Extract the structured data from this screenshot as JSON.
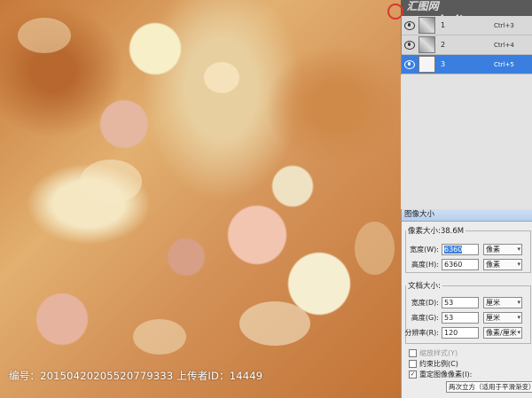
{
  "watermark": {
    "text": "编号：20150420205520779333 上传者ID：14449"
  },
  "logo": {
    "text": "汇图网 www.huitu.com"
  },
  "layers": [
    {
      "name": "1",
      "shortcut": "Ctrl+3",
      "active": false
    },
    {
      "name": "2",
      "shortcut": "Ctrl+4",
      "active": false
    },
    {
      "name": "3",
      "shortcut": "Ctrl+5",
      "active": true
    }
  ],
  "dialog": {
    "title": "图像大小",
    "pixel_dimensions": {
      "legend": "像素大小:38.6M",
      "width": {
        "label": "宽度(W):",
        "value": "6360",
        "unit": "像素"
      },
      "height": {
        "label": "高度(H):",
        "value": "6360",
        "unit": "像素"
      }
    },
    "document_size": {
      "legend": "文档大小:",
      "width": {
        "label": "宽度(D):",
        "value": "53",
        "unit": "厘米"
      },
      "height": {
        "label": "高度(G):",
        "value": "53",
        "unit": "厘米"
      },
      "resolution": {
        "label": "分辨率(R):",
        "value": "120",
        "unit": "像素/厘米"
      }
    },
    "scale_styles": {
      "label": "缩放样式(Y)",
      "checked": false,
      "enabled": false
    },
    "constrain": {
      "label": "约束比例(C)",
      "checked": false
    },
    "resample": {
      "label": "重定图像像素(I):",
      "checked": true
    },
    "resample_method": "两次立方（适用于平滑渐变）"
  }
}
